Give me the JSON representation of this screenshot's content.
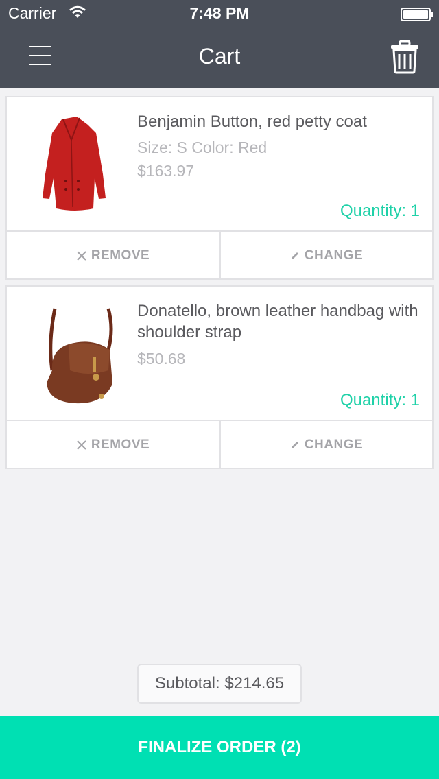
{
  "status_bar": {
    "carrier": "Carrier",
    "time": "7:48 PM"
  },
  "nav": {
    "title": "Cart",
    "menu_icon": "hamburger-menu-icon",
    "trash_icon": "trash-icon"
  },
  "items": [
    {
      "title": "Benjamin Button, red petty coat",
      "details": "Size: S Color: Red",
      "price": "$163.97",
      "quantity": "Quantity: 1",
      "remove_label": "REMOVE",
      "change_label": "CHANGE",
      "image": "red-coat-image"
    },
    {
      "title": "Donatello, brown leather handbag with shoulder strap",
      "price": "$50.68",
      "quantity": "Quantity: 1",
      "remove_label": "REMOVE",
      "change_label": "CHANGE",
      "image": "brown-handbag-image"
    }
  ],
  "subtotal": "Subtotal: $214.65",
  "finalize_label": "FINALIZE ORDER (2)",
  "colors": {
    "header": "#4a4f59",
    "accent": "#00e0b3",
    "quantity": "#1fd1a8"
  }
}
